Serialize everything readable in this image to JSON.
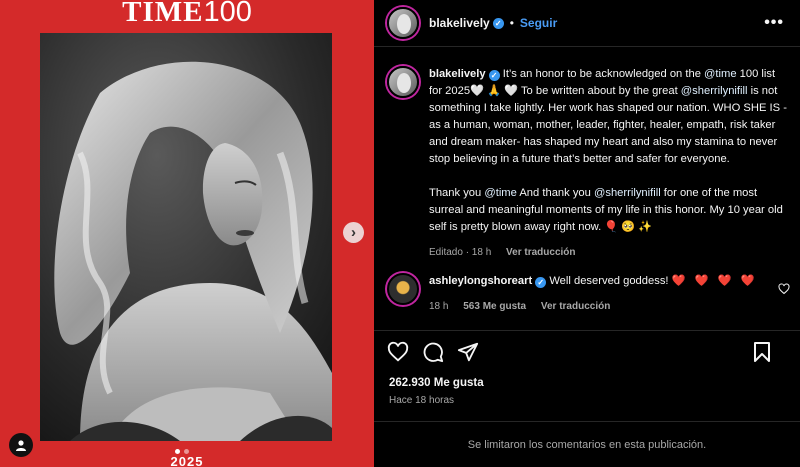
{
  "media": {
    "masthead_time": "TIME",
    "masthead_number": "100",
    "year": "2025",
    "accent_color": "#d42a2a",
    "next_icon": "chevron-right-icon",
    "tag_icon": "user-icon"
  },
  "header": {
    "username": "blakelively",
    "separator": "•",
    "follow_label": "Seguir",
    "more_icon": "more-options-icon"
  },
  "caption": {
    "username": "blakelively",
    "p1_a": " It’s an honor to be acknowledged on the ",
    "p1_m1": "@time",
    "p1_b": " 100 list for 2025🤍 🙏 🤍  To be written about by the great ",
    "p1_m2": "@sherrilynifill",
    "p1_c": " is not something I take lightly. Her work has shaped our nation. WHO SHE IS - as a human, woman, mother, leader, fighter, healer, empath, risk taker and dream maker- has shaped my heart and also my stamina to never stop believing in a future that’s better and safer for everyone.",
    "p2_a": "Thank you ",
    "p2_m1": "@time",
    "p2_b": " And thank you ",
    "p2_m2": "@sherrilynifill",
    "p2_c": " for one of the most surreal and meaningful moments of my life in this honor. My 10 year old self is pretty blown away right now. 🎈 🥺 ✨",
    "edited": "Editado · 18 h",
    "translate": "Ver traducción"
  },
  "comment": {
    "username": "ashleylongshoreart",
    "text": " Well deserved goddess! ",
    "hearts": "❤️ ❤️ ❤️ ❤️",
    "time": "18 h",
    "likes": "563 Me gusta",
    "translate": "Ver traducción"
  },
  "actions": {
    "likes_count": "262.930 Me gusta",
    "posted": "Hace 18 horas",
    "comments_disabled": "Se limitaron los comentarios en esta publicación."
  },
  "icons": [
    "heart-icon",
    "comment-icon",
    "share-icon",
    "bookmark-icon",
    "verified-badge-icon"
  ]
}
